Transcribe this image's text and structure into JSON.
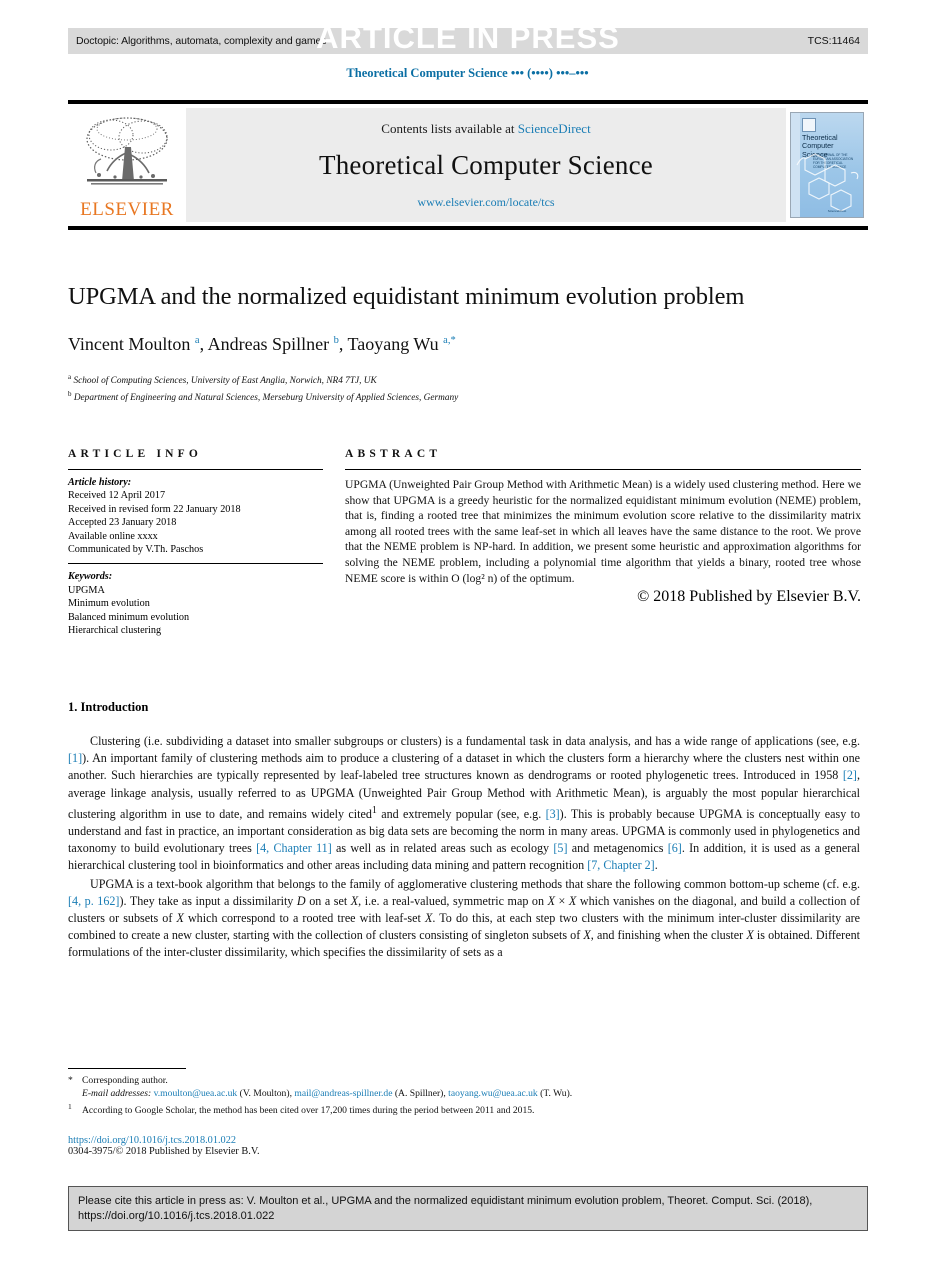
{
  "header": {
    "doctopic": "Doctopic: Algorithms, automata, complexity and games",
    "article_in_press": "ARTICLE IN PRESS",
    "article_code": "TCS:11464",
    "running_head": "Theoretical Computer Science ••• (••••) •••–•••"
  },
  "masthead": {
    "publisher": "ELSEVIER",
    "contents_prefix": "Contents lists available at ",
    "contents_link": "ScienceDirect",
    "journal_title": "Theoretical Computer Science",
    "journal_url": "www.elsevier.com/locate/tcs",
    "cover": {
      "title": "Theoretical Computer Science",
      "subtitle": "THE JOURNAL OF THE EUROPEAN ASSOCIATION FOR THEORETICAL COMPUTER SCIENCE",
      "footer": "ScienceDirect"
    }
  },
  "article": {
    "title": "UPGMA and the normalized equidistant minimum evolution problem",
    "authors_html": "Vincent Moulton <sup>a</sup>, Andreas Spillner <sup>b</sup>, Taoyang Wu <sup>a,*</sup>",
    "authors_plain": "Vincent Moulton a, Andreas Spillner b, Taoyang Wu a,*",
    "affiliations": [
      {
        "marker": "a",
        "text": "School of Computing Sciences, University of East Anglia, Norwich, NR4 7TJ, UK"
      },
      {
        "marker": "b",
        "text": "Department of Engineering and Natural Sciences, Merseburg University of Applied Sciences, Germany"
      }
    ]
  },
  "article_info": {
    "heading": "ARTICLE INFO",
    "history_label": "Article history:",
    "history": [
      "Received 12 April 2017",
      "Received in revised form 22 January 2018",
      "Accepted 23 January 2018",
      "Available online xxxx",
      "Communicated by V.Th. Paschos"
    ],
    "keywords_label": "Keywords:",
    "keywords": [
      "UPGMA",
      "Minimum evolution",
      "Balanced minimum evolution",
      "Hierarchical clustering"
    ]
  },
  "abstract": {
    "heading": "ABSTRACT",
    "text": "UPGMA (Unweighted Pair Group Method with Arithmetic Mean) is a widely used clustering method. Here we show that UPGMA is a greedy heuristic for the normalized equidistant minimum evolution (NEME) problem, that is, finding a rooted tree that minimizes the minimum evolution score relative to the dissimilarity matrix among all rooted trees with the same leaf-set in which all leaves have the same distance to the root. We prove that the NEME problem is NP-hard. In addition, we present some heuristic and approximation algorithms for solving the NEME problem, including a polynomial time algorithm that yields a binary, rooted tree whose NEME score is within O (log² n) of the optimum.",
    "copyright": "© 2018 Published by Elsevier B.V."
  },
  "body": {
    "section_heading": "1. Introduction",
    "paragraph1": "Clustering (i.e. subdividing a dataset into smaller subgroups or clusters) is a fundamental task in data analysis, and has a wide range of applications (see, e.g. [1]). An important family of clustering methods aim to produce a clustering of a dataset in which the clusters form a hierarchy where the clusters nest within one another. Such hierarchies are typically represented by leaf-labeled tree structures known as dendrograms or rooted phylogenetic trees. Introduced in 1958 [2], average linkage analysis, usually referred to as UPGMA (Unweighted Pair Group Method with Arithmetic Mean), is arguably the most popular hierarchical clustering algorithm in use to date, and remains widely cited¹ and extremely popular (see, e.g. [3]). This is probably because UPGMA is conceptually easy to understand and fast in practice, an important consideration as big data sets are becoming the norm in many areas. UPGMA is commonly used in phylogenetics and taxonomy to build evolutionary trees [4, Chapter 11] as well as in related areas such as ecology [5] and metagenomics [6]. In addition, it is used as a general hierarchical clustering tool in bioinformatics and other areas including data mining and pattern recognition [7, Chapter 2].",
    "paragraph2": "UPGMA is a text-book algorithm that belongs to the family of agglomerative clustering methods that share the following common bottom-up scheme (cf. e.g. [4, p. 162]). They take as input a dissimilarity D on a set X, i.e. a real-valued, symmetric map on X × X which vanishes on the diagonal, and build a collection of clusters or subsets of X which correspond to a rooted tree with leaf-set X. To do this, at each step two clusters with the minimum inter-cluster dissimilarity are combined to create a new cluster, starting with the collection of clusters consisting of singleton subsets of X, and finishing when the cluster X is obtained. Different formulations of the inter-cluster dissimilarity, which specifies the dissimilarity of sets as a"
  },
  "footnotes": {
    "corresponding": "Corresponding author.",
    "email_label": "E-mail addresses:",
    "emails": [
      {
        "address": "v.moulton@uea.ac.uk",
        "owner": "(V. Moulton)"
      },
      {
        "address": "mail@andreas-spillner.de",
        "owner": "(A. Spillner)"
      },
      {
        "address": "taoyang.wu@uea.ac.uk",
        "owner": "(T. Wu)"
      }
    ],
    "note1_marker": "1",
    "note1": "According to Google Scholar, the method has been cited over 17,200 times during the period between 2011 and 2015.",
    "doi": "https://doi.org/10.1016/j.tcs.2018.01.022",
    "issn_copyright": "0304-3975/© 2018 Published by Elsevier B.V."
  },
  "cite_box": {
    "line1": "Please cite this article in press as: V. Moulton et al., UPGMA and the normalized equidistant minimum evolution problem, Theoret. Comput. Sci. (2018),",
    "line2": "https://doi.org/10.1016/j.tcs.2018.01.022"
  },
  "colors": {
    "link": "#1a7db5",
    "elsevier_orange": "#E87722",
    "band_gray": "#d9d9d9",
    "masthead_gray": "#ececec",
    "cite_box_gray": "#d4d4d4"
  }
}
